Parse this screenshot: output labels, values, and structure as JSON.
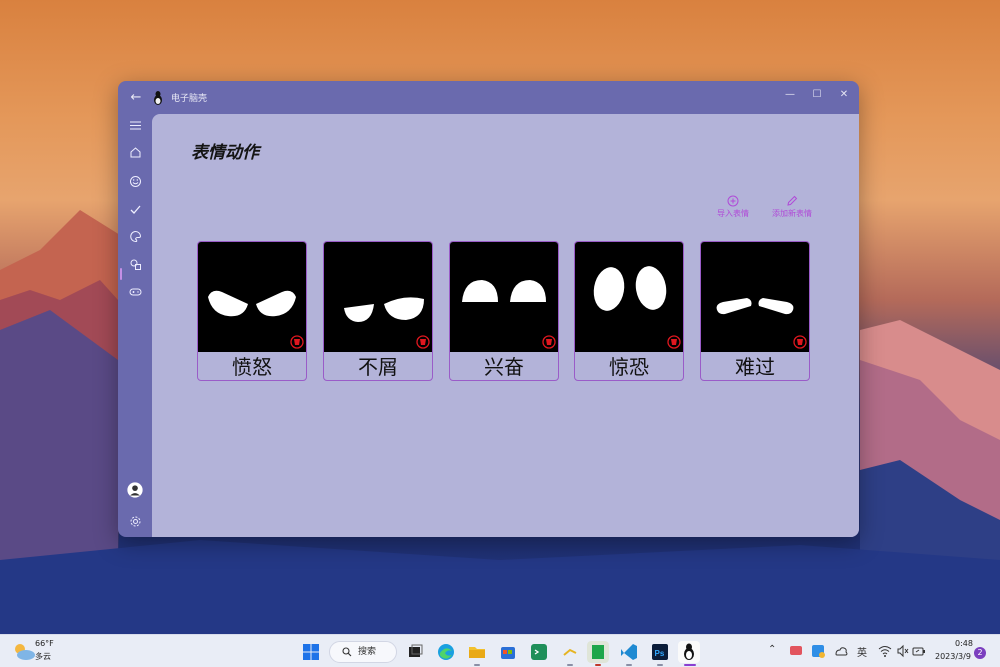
{
  "window": {
    "title": "电子脑壳",
    "back_glyph": "←",
    "minimize_glyph": "—",
    "maximize_glyph": "☐",
    "close_glyph": "✕"
  },
  "sidebar": {
    "items": [
      {
        "name": "menu",
        "icon": "hamburger-icon"
      },
      {
        "name": "home",
        "icon": "home-icon"
      },
      {
        "name": "emoji",
        "icon": "smile-icon"
      },
      {
        "name": "check",
        "icon": "check-icon"
      },
      {
        "name": "expressions",
        "icon": "palette-icon",
        "selected": true
      },
      {
        "name": "shapes",
        "icon": "shapes-icon"
      },
      {
        "name": "gamepad",
        "icon": "gamepad-icon"
      },
      {
        "name": "account",
        "icon": "avatar-icon"
      },
      {
        "name": "settings",
        "icon": "gear-icon"
      }
    ]
  },
  "page": {
    "title": "表情动作",
    "actions": {
      "import_label": "导入表情",
      "add_label": "添加新表情"
    }
  },
  "expressions": [
    {
      "label": "愤怒",
      "eyes": "angry"
    },
    {
      "label": "不屑",
      "eyes": "disdain"
    },
    {
      "label": "兴奋",
      "eyes": "excited"
    },
    {
      "label": "惊恐",
      "eyes": "terrified"
    },
    {
      "label": "难过",
      "eyes": "sad"
    }
  ],
  "taskbar": {
    "weather_temp": "66°F",
    "weather_cond": "多云",
    "search_label": "搜索",
    "ime": "英",
    "time": "0:48",
    "date": "2023/3/9",
    "notification_count": "2"
  },
  "colors": {
    "window_frame": "#6a6aae",
    "content_bg": "#b3b3d9",
    "accent": "#b04ad8",
    "card_border": "#9a5cc8"
  }
}
